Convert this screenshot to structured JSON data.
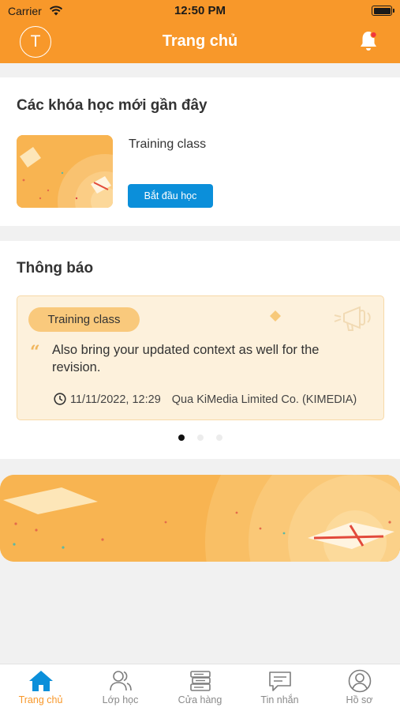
{
  "status_bar": {
    "carrier": "Carrier",
    "time": "12:50 PM"
  },
  "header": {
    "avatar_initial": "T",
    "title": "Trang chủ"
  },
  "recent_courses": {
    "title": "Các khóa học mới gần đây",
    "items": [
      {
        "name": "Training class",
        "start_label": "Bắt đầu học"
      }
    ]
  },
  "announcements": {
    "title": "Thông báo",
    "items": [
      {
        "tag": "Training class",
        "message": "Also bring your updated context as well for the revision.",
        "datetime": "11/11/2022, 12:29",
        "sender": "Qua KiMedia Limited Co. (KIMEDIA)"
      }
    ],
    "page_count": 3,
    "active_page": 1
  },
  "tabs": [
    {
      "label": "Trang chủ",
      "icon": "home-icon",
      "active": true
    },
    {
      "label": "Lớp học",
      "icon": "users-icon",
      "active": false
    },
    {
      "label": "Cửa hàng",
      "icon": "books-icon",
      "active": false
    },
    {
      "label": "Tin nhắn",
      "icon": "message-icon",
      "active": false
    },
    {
      "label": "Hồ sơ",
      "icon": "profile-icon",
      "active": false
    }
  ],
  "colors": {
    "brand": "#f8982a",
    "primary_button": "#0b8fda",
    "notice_background": "#fdf1dc",
    "tab_inactive": "#8a8a8a"
  }
}
